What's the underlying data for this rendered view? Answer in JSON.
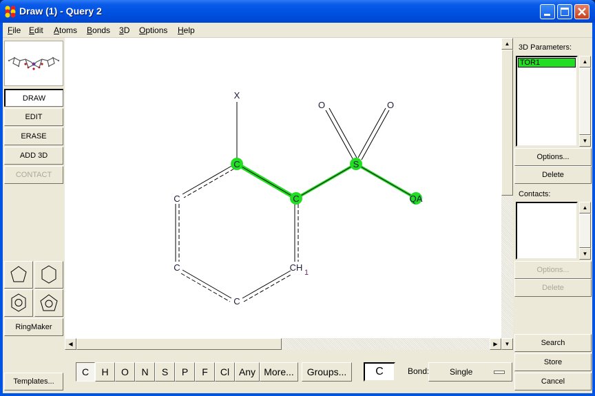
{
  "window": {
    "title": "Draw (1) - Query 2",
    "controls": [
      "minimize",
      "maximize",
      "close"
    ]
  },
  "menu": [
    {
      "label": "File",
      "mnemonic": "F",
      "rest": "ile"
    },
    {
      "label": "Edit",
      "mnemonic": "E",
      "rest": "dit"
    },
    {
      "label": "Atoms",
      "mnemonic": "A",
      "rest": "toms"
    },
    {
      "label": "Bonds",
      "mnemonic": "B",
      "rest": "onds"
    },
    {
      "label": "3D",
      "mnemonic": "3",
      "rest": "D"
    },
    {
      "label": "Options",
      "mnemonic": "O",
      "rest": "ptions"
    },
    {
      "label": "Help",
      "mnemonic": "H",
      "rest": "elp"
    }
  ],
  "left": {
    "modes": [
      {
        "label": "DRAW",
        "state": "active"
      },
      {
        "label": "EDIT",
        "state": "normal"
      },
      {
        "label": "ERASE",
        "state": "normal"
      },
      {
        "label": "ADD 3D",
        "state": "normal"
      },
      {
        "label": "CONTACT",
        "state": "disabled"
      }
    ],
    "rings": [
      "cyclopentane",
      "cyclohexane",
      "benzene",
      "cyclopentadienyl"
    ],
    "ringmaker_label": "RingMaker",
    "templates_label": "Templates..."
  },
  "molecule": {
    "highlight_color": "#22dd22",
    "atoms": [
      {
        "id": "x",
        "label": "X"
      },
      {
        "id": "c1",
        "label": "C",
        "highlighted": true
      },
      {
        "id": "c2",
        "label": "C",
        "highlighted": true
      },
      {
        "id": "s",
        "label": "S",
        "highlighted": true
      },
      {
        "id": "o1",
        "label": "O"
      },
      {
        "id": "o2",
        "label": "O"
      },
      {
        "id": "qa",
        "label": "QA",
        "highlighted": true
      },
      {
        "id": "c3",
        "label": "C"
      },
      {
        "id": "c4",
        "label": "C"
      },
      {
        "id": "c5",
        "label": "C"
      },
      {
        "id": "ch1",
        "label": "CH",
        "subscript": "1"
      }
    ]
  },
  "bottom": {
    "elements": [
      "C",
      "H",
      "O",
      "N",
      "S",
      "P",
      "F",
      "Cl",
      "Any",
      "More..."
    ],
    "active_element": "C",
    "groups_label": "Groups...",
    "current_element": "C",
    "bond_label": "Bond:",
    "bond_value": "Single"
  },
  "right": {
    "params_label": "3D Parameters:",
    "params_items": [
      "TOR1"
    ],
    "params_options": "Options...",
    "params_delete": "Delete",
    "contacts_label": "Contacts:",
    "contacts_options": "Options...",
    "contacts_delete": "Delete",
    "search": "Search",
    "store": "Store",
    "cancel": "Cancel"
  }
}
